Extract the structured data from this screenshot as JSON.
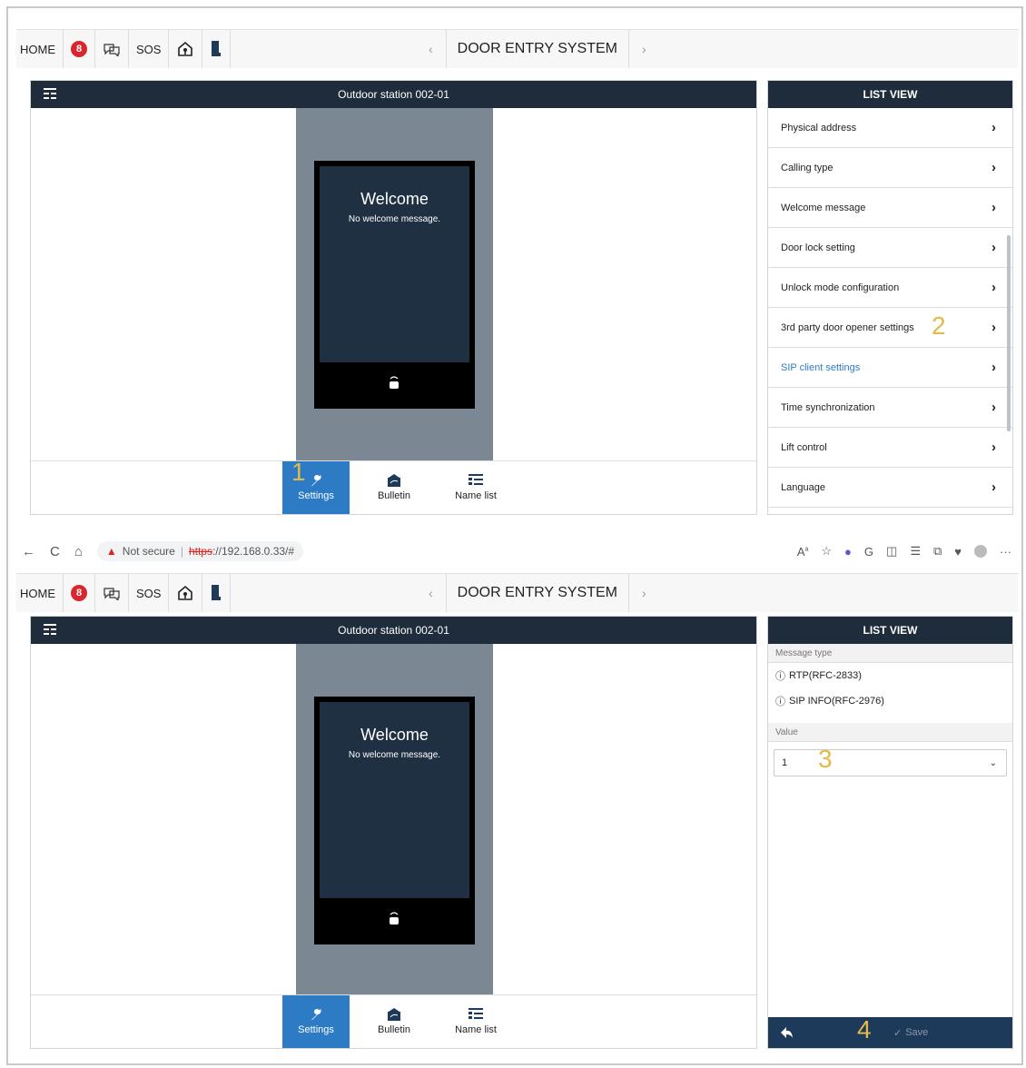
{
  "nav": {
    "home_label": "HOME",
    "badge_count": "8",
    "sos_label": "SOS",
    "title": "DOOR ENTRY SYSTEM",
    "prev": "‹",
    "next": "›"
  },
  "browser": {
    "back": "←",
    "reload": "C",
    "home": "⌂",
    "security_text": "Not secure",
    "url_scheme": "https",
    "url_rest": "://192.168.0.33/#",
    "more": "···"
  },
  "viewer": {
    "header_title": "Outdoor station 002-01",
    "welcome": "Welcome",
    "welcome_msg": "No welcome message.",
    "tabs": [
      "Settings",
      "Bulletin",
      "Name list"
    ]
  },
  "listview": {
    "title": "LIST VIEW",
    "items": [
      "Physical address",
      "Calling type",
      "Welcome message",
      "Door lock setting",
      "Unlock mode configuration",
      "3rd party door opener settings",
      "SIP client settings",
      "Time synchronization",
      "Lift control",
      "Language"
    ],
    "selected_item": "SIP client settings",
    "message_type_label": "Message type",
    "options": [
      "RTP(RFC-2833)",
      "SIP INFO(RFC-2976)"
    ],
    "value_label": "Value",
    "value_selected": "1",
    "save_label": "Save"
  },
  "steps": [
    "1",
    "2",
    "3",
    "4"
  ],
  "colors": {
    "header_bg": "#1e2c3c",
    "active_tab": "#2d7bc4",
    "badge": "#d7262e",
    "step_marker": "#e3b94a"
  }
}
